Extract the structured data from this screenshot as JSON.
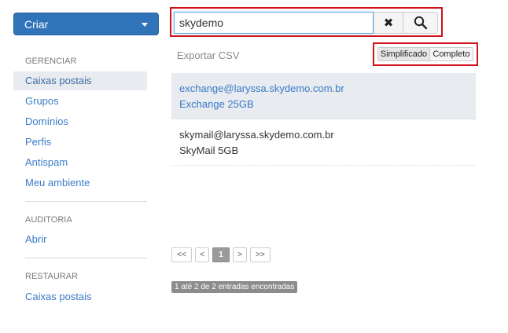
{
  "sidebar": {
    "create_label": "Criar",
    "sections": [
      {
        "title": "GERENCIAR",
        "items": [
          "Caixas postais",
          "Grupos",
          "Domínios",
          "Perfis",
          "Antispam",
          "Meu ambiente"
        ]
      },
      {
        "title": "AUDITORIA",
        "items": [
          "Abrir"
        ]
      },
      {
        "title": "RESTAURAR",
        "items": [
          "Caixas postais"
        ]
      }
    ]
  },
  "search": {
    "value": "skydemo",
    "clear_icon": "close-icon",
    "search_icon": "search-icon"
  },
  "toolbar": {
    "export_label": "Exportar CSV",
    "view_simplified": "Simplificado",
    "view_complete": "Completo"
  },
  "results": [
    {
      "email": "exchange@laryssa.skydemo.com.br",
      "plan": "Exchange 25GB"
    },
    {
      "email": "skymail@laryssa.skydemo.com.br",
      "plan": "SkyMail 5GB"
    }
  ],
  "pagination": {
    "first": "<<",
    "prev": "<",
    "current": "1",
    "next": ">",
    "last": ">>"
  },
  "summary": "1 até 2 de 2 entradas encontradas"
}
